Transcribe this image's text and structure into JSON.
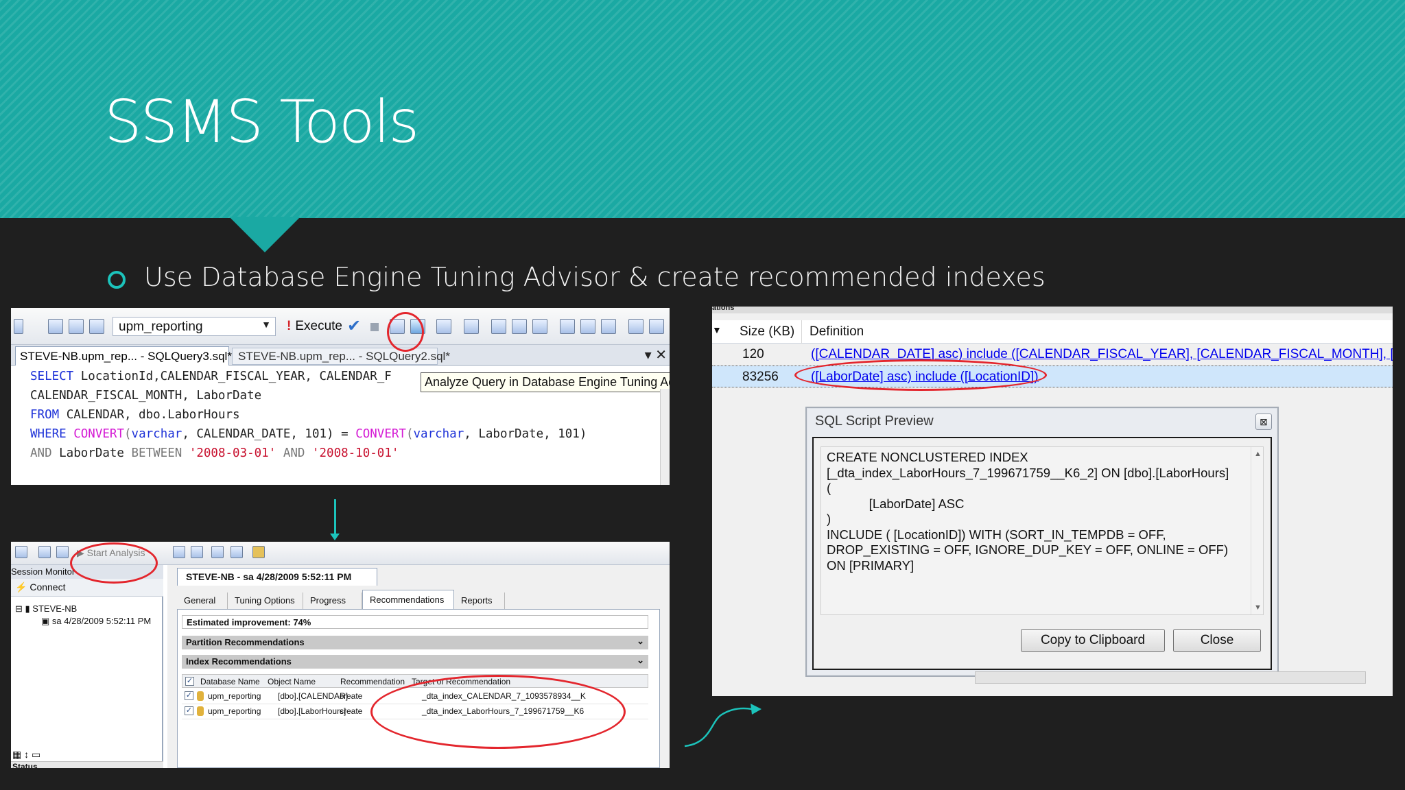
{
  "slide": {
    "title": "SSMS Tools",
    "bullet": "Use Database Engine Tuning Advisor & create recommended indexes"
  },
  "editor": {
    "database": "upm_reporting",
    "execute_label": "Execute",
    "tab_active": "STEVE-NB.upm_rep... - SQLQuery3.sql*",
    "tab_inactive": "STEVE-NB.upm_rep... - SQLQuery2.sql*",
    "tooltip": "Analyze Query in Database Engine Tuning Advisor",
    "code_lines": [
      {
        "kw": "SELECT",
        "rest": " LocationId,CALENDAR_FISCAL_YEAR, CALENDAR_F"
      },
      {
        "kw": "",
        "rest": "CALENDAR_FISCAL_MONTH, LaborDate"
      },
      {
        "kw": "FROM",
        "rest": " CALENDAR, dbo.LaborHours"
      },
      {
        "kw": "WHERE",
        "rest": ""
      },
      {
        "kw": "AND",
        "rest": ""
      }
    ],
    "where_line": {
      "kw": "WHERE",
      "fn1": "CONVERT",
      "type1": "varchar",
      "mid": ", CALENDAR_DATE, 101) = ",
      "fn2": "CONVERT",
      "type2": "varchar",
      "tail": ", LaborDate, 101)"
    },
    "and_line": {
      "kw": "AND",
      "col": " LaborDate ",
      "between": "BETWEEN",
      "date1": "'2008-03-01'",
      "and2": "AND",
      "date2": "'2008-10-01'"
    }
  },
  "dta": {
    "start_analysis": "Start Analysis",
    "session_monitor": "Session Monitor",
    "connect": "Connect",
    "server": "STEVE-NB",
    "session_node": "sa 4/28/2009 5:52:11 PM",
    "status_label": "Status",
    "session_tab": "STEVE-NB - sa 4/28/2009 5:52:11 PM",
    "tabs": [
      "General",
      "Tuning Options",
      "Progress",
      "Recommendations",
      "Reports"
    ],
    "active_tab": "Recommendations",
    "estimated_improvement_label": "Estimated improvement:",
    "estimated_improvement_value": "74%",
    "partition_recommendations": "Partition Recommendations",
    "index_recommendations": "Index Recommendations",
    "columns": [
      "Database Name",
      "Object Name",
      "Recommendation",
      "Target of Recommendation"
    ],
    "rows": [
      {
        "db": "upm_reporting",
        "object": "[dbo].[CALENDAR]",
        "rec": "create",
        "target": "_dta_index_CALENDAR_7_1093578934__K"
      },
      {
        "db": "upm_reporting",
        "object": "[dbo].[LaborHours]",
        "rec": "create",
        "target": "_dta_index_LaborHours_7_199671759__K6"
      }
    ]
  },
  "results": {
    "top_label": "ations",
    "col_size": "Size (KB)",
    "col_definition": "Definition",
    "rows": [
      {
        "size": "120",
        "definition": "([CALENDAR_DATE] asc) include ([CALENDAR_FISCAL_YEAR], [CALENDAR_FISCAL_MONTH], [CAL"
      },
      {
        "size": "83256",
        "definition": "([LaborDate] asc) include ([LocationID])"
      }
    ],
    "dialog_title": "SQL Script Preview",
    "script": "CREATE NONCLUSTERED INDEX\n[_dta_index_LaborHours_7_199671759__K6_2] ON [dbo].[LaborHours]\n(\n            [LaborDate] ASC\n)\nINCLUDE ( [LocationID]) WITH (SORT_IN_TEMPDB = OFF,\nDROP_EXISTING = OFF, IGNORE_DUP_KEY = OFF, ONLINE = OFF)\nON [PRIMARY]",
    "copy_button": "Copy to Clipboard",
    "close_button": "Close"
  },
  "colors": {
    "header_teal": "#1aa9a3",
    "accent": "#1cc3bb",
    "highlight_red": "#e3262d",
    "background": "#1f1f1f"
  }
}
